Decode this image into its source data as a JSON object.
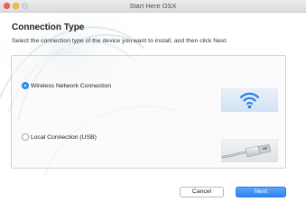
{
  "window": {
    "title": "Start Here OSX"
  },
  "page": {
    "title": "Connection Type",
    "instruction": "Select the connection type of the device you want to install, and then click Next."
  },
  "options": [
    {
      "label": "Wireless Network Connection",
      "selected": true,
      "icon": "wifi-icon"
    },
    {
      "label": "Local Connection (USB)",
      "selected": false,
      "icon": "usb-cable-icon"
    }
  ],
  "buttons": {
    "cancel_label": "Cancel",
    "next_label": "Next"
  },
  "colors": {
    "accent": "#3a8ef6",
    "wifi_tile": "#2d7fe0"
  }
}
